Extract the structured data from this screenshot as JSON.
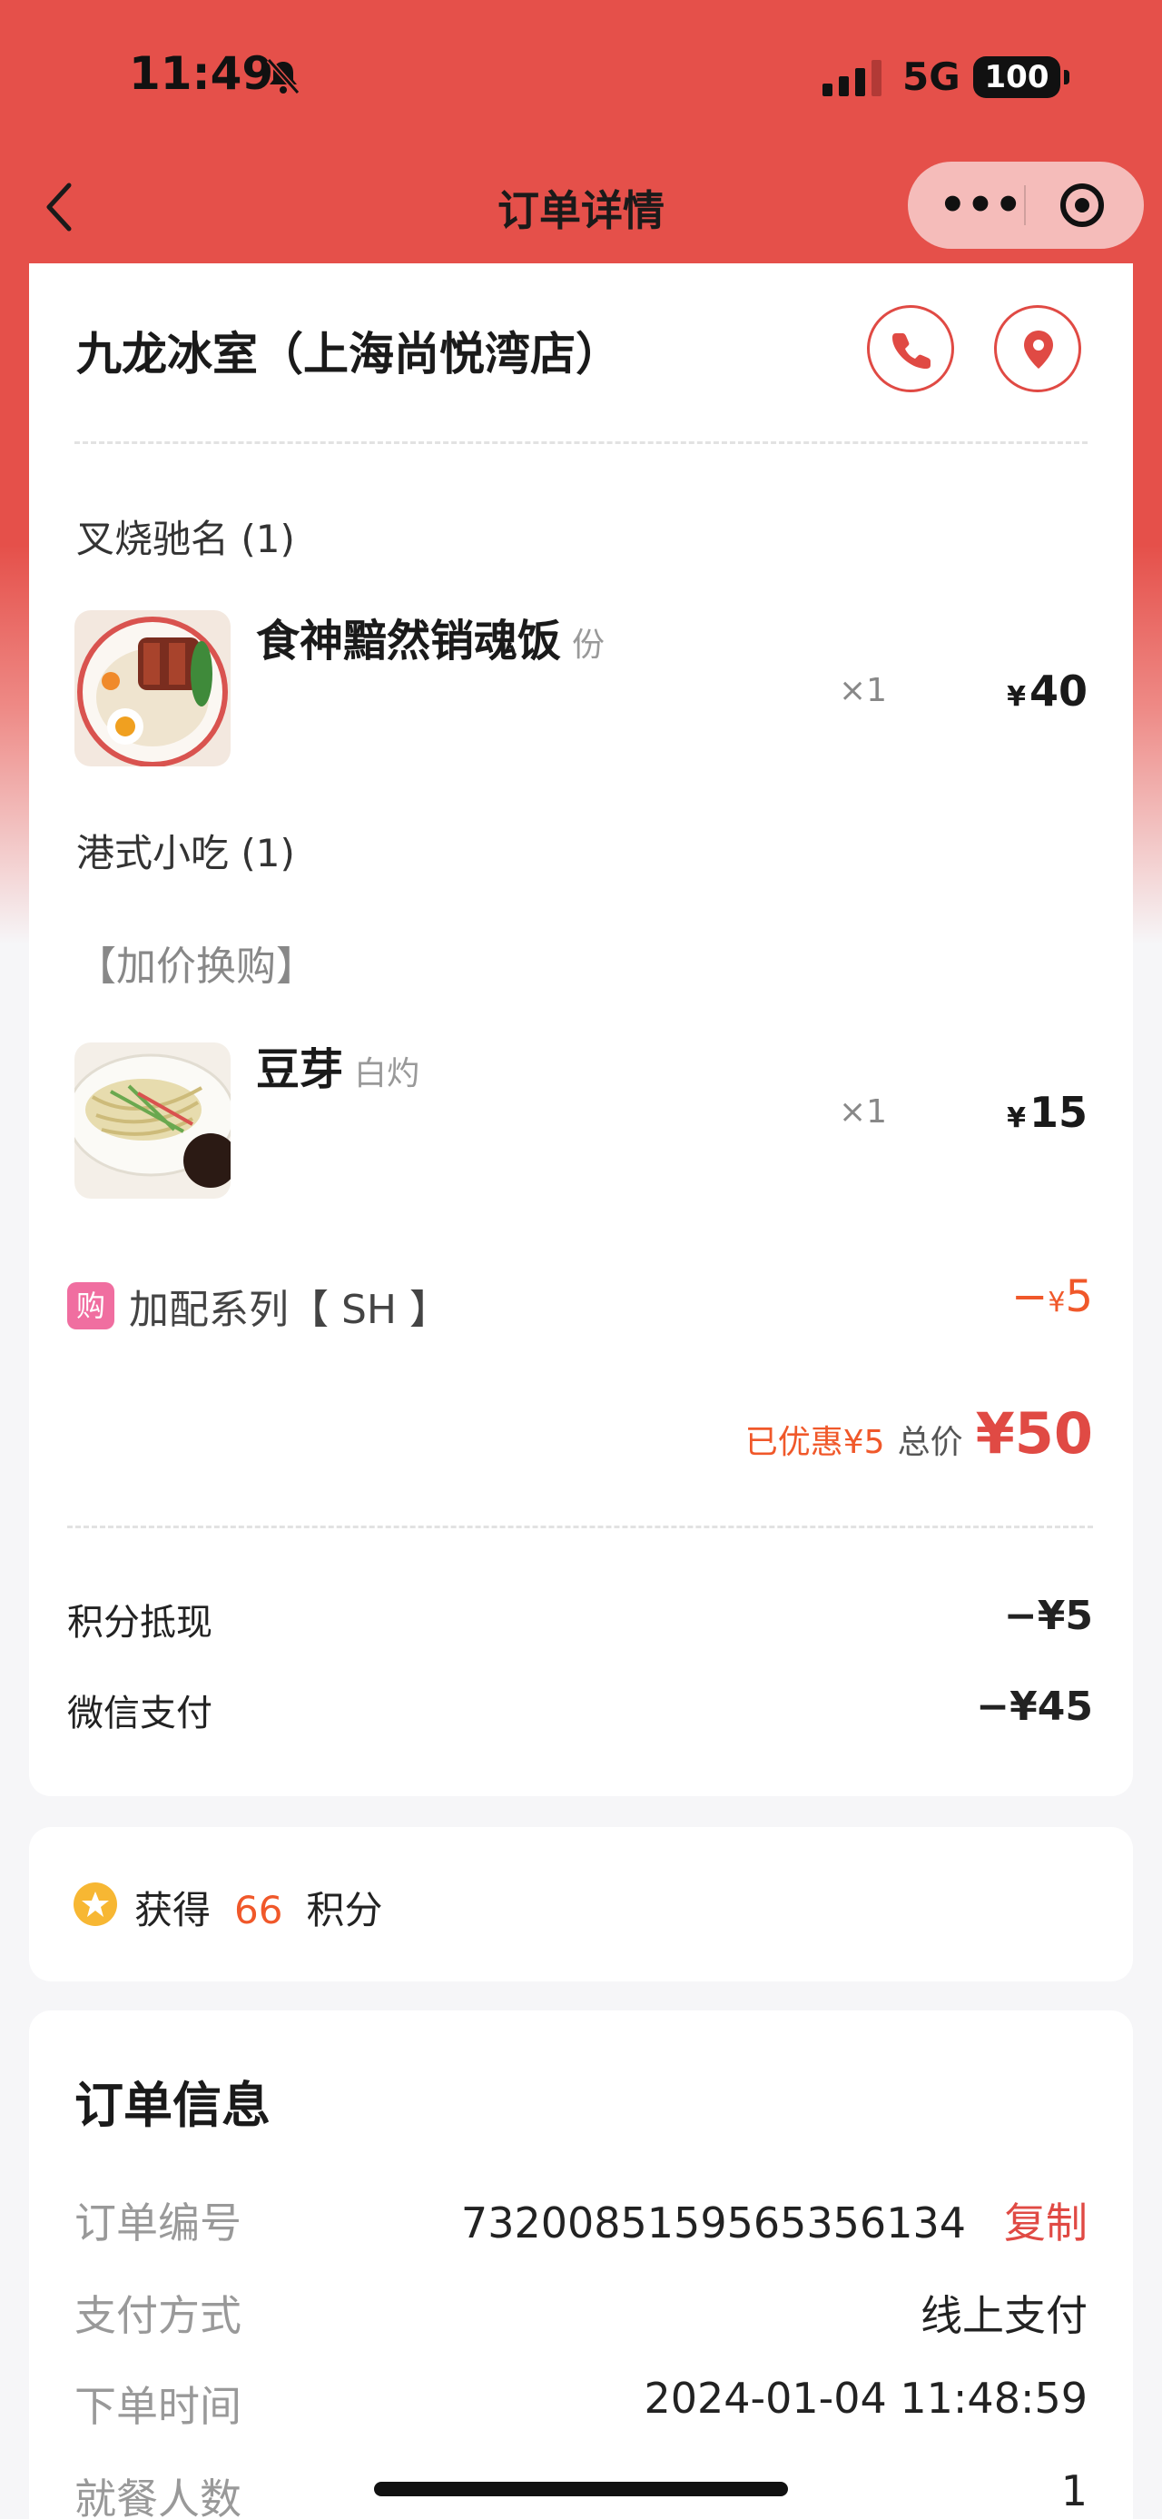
{
  "status_bar": {
    "time": "11:49",
    "network": "5G",
    "battery": "100"
  },
  "nav": {
    "title": "订单详情",
    "more": "•••"
  },
  "store": {
    "name": "九龙冰室（上海尚悦湾店）"
  },
  "categories": [
    {
      "name": "叉烧驰名 (1)"
    },
    {
      "name": "港式小吃 (1)"
    }
  ],
  "items": [
    {
      "name": "食神黯然销魂饭",
      "spec": "份",
      "qty": "×1",
      "currency": "¥",
      "price": "40"
    },
    {
      "name": "豆芽",
      "spec": "白灼",
      "qty": "×1",
      "currency": "¥",
      "price": "15"
    }
  ],
  "addon_label": "【加价换购】",
  "promotion": {
    "tag": "购",
    "name": "加配系列【 SH 】",
    "prefix": "−",
    "currency": "¥",
    "amount": "5"
  },
  "totals": {
    "saved": "已优惠¥5",
    "label": "总价",
    "total": "¥50"
  },
  "payments": [
    {
      "label": "积分抵现",
      "value": "−¥5"
    },
    {
      "label": "微信支付",
      "value": "−¥45"
    }
  ],
  "points": {
    "prefix": "获得",
    "value": "66",
    "suffix": "积分"
  },
  "order_info": {
    "title": "订单信息",
    "copy_label": "复制",
    "rows": [
      {
        "label": "订单编号",
        "value": "7320085159565356134"
      },
      {
        "label": "支付方式",
        "value": "线上支付"
      },
      {
        "label": "下单时间",
        "value": "2024-01-04 11:48:59"
      },
      {
        "label": "就餐人数",
        "value": "1"
      }
    ]
  },
  "colors": {
    "brand_red": "#e5504a",
    "accent_orange": "#f0582a",
    "promo_pink": "#f06ea0"
  }
}
